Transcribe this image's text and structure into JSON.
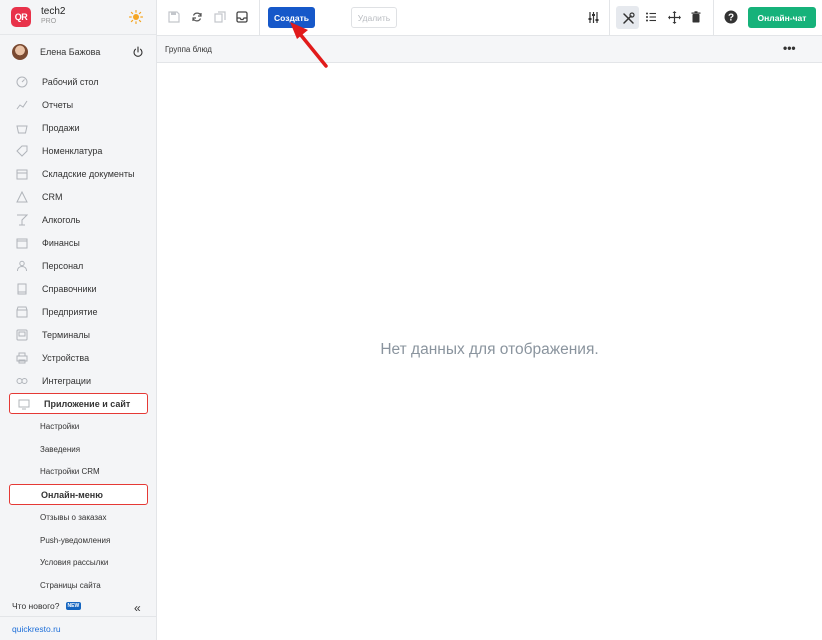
{
  "brand": {
    "logo_text": "QR",
    "name": "tech2",
    "plan": "PRO"
  },
  "user": {
    "name": "Елена Бажова"
  },
  "nav": {
    "items": [
      {
        "label": "Рабочий стол",
        "icon": "dashboard-icon"
      },
      {
        "label": "Отчеты",
        "icon": "chart-icon"
      },
      {
        "label": "Продажи",
        "icon": "basket-icon"
      },
      {
        "label": "Номенклатура",
        "icon": "tag-icon"
      },
      {
        "label": "Складские документы",
        "icon": "box-icon"
      },
      {
        "label": "CRM",
        "icon": "people-icon"
      },
      {
        "label": "Алкоголь",
        "icon": "glass-icon"
      },
      {
        "label": "Финансы",
        "icon": "wallet-icon"
      },
      {
        "label": "Персонал",
        "icon": "staff-icon"
      },
      {
        "label": "Справочники",
        "icon": "book-icon"
      },
      {
        "label": "Предприятие",
        "icon": "store-icon"
      },
      {
        "label": "Терминалы",
        "icon": "terminal-icon"
      },
      {
        "label": "Устройства",
        "icon": "printer-icon"
      },
      {
        "label": "Интеграции",
        "icon": "link-icon"
      }
    ],
    "app_section": {
      "label": "Приложение и сайт",
      "sub_items": [
        "Настройки",
        "Заведения",
        "Настройки CRM",
        "Онлайн-меню",
        "Отзывы о заказах",
        "Push-уведомления",
        "Условия рассылки",
        "Страницы сайта"
      ]
    }
  },
  "whatsnew": {
    "label": "Что нового?",
    "badge": "NEW"
  },
  "footer": {
    "link": "quickresto.ru"
  },
  "toolbar": {
    "create_label": "Создать",
    "delete_label": "Удалить",
    "chat_label": "Онлайн-чат"
  },
  "table": {
    "column": "Группа блюд",
    "empty_text": "Нет данных для отображения."
  },
  "colors": {
    "primary": "#1658c9",
    "chat": "#16b27a",
    "highlight": "#e53935",
    "logo": "#e8324a"
  }
}
